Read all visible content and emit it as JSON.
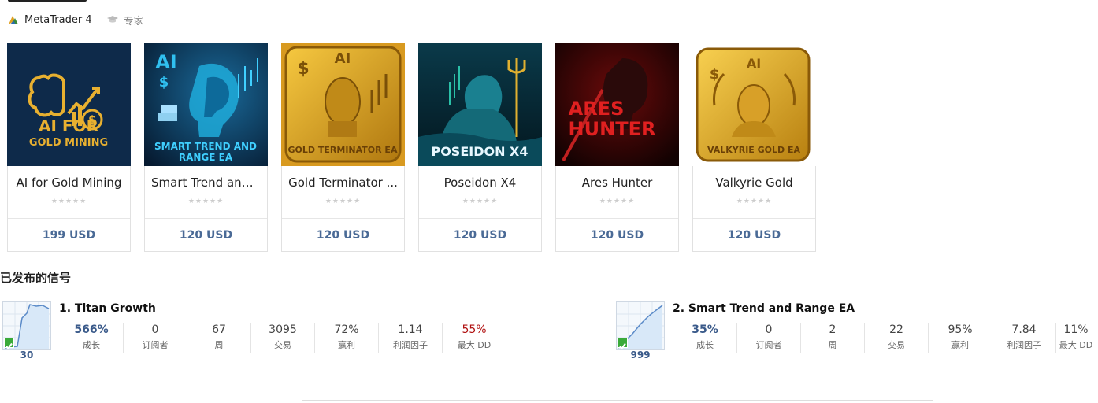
{
  "tabs": [
    {
      "label": "MetaTrader 4",
      "icon": "metatrader-icon"
    },
    {
      "label": "专家",
      "icon": "graduation-cap-icon"
    }
  ],
  "products": [
    {
      "image_text_line1": "AI FOR",
      "image_text_line2": "GOLD MINING",
      "name": "AI for Gold Mining",
      "stars": "★★★★★",
      "price": "199 USD"
    },
    {
      "image_text_line1": "SMART TREND AND",
      "image_text_line2": "RANGE EA",
      "name": "Smart Trend and ...",
      "stars": "★★★★★",
      "price": "120 USD"
    },
    {
      "image_text_line1": "GOLD TERMINATOR EA",
      "image_text_line2": "AI",
      "name": "Gold Terminator ...",
      "stars": "★★★★★",
      "price": "120 USD"
    },
    {
      "image_text_line1": "POSEIDON X4",
      "image_text_line2": "",
      "name": "Poseidon X4",
      "stars": "★★★★★",
      "price": "120 USD"
    },
    {
      "image_text_line1": "ARES",
      "image_text_line2": "HUNTER",
      "name": "Ares Hunter",
      "stars": "★★★★★",
      "price": "120 USD"
    },
    {
      "image_text_line1": "VALKYRIE GOLD EA",
      "image_text_line2": "AI",
      "name": "Valkyrie Gold",
      "stars": "★★★★★",
      "price": "120 USD"
    }
  ],
  "signals_title": "已发布的信号",
  "signals": [
    {
      "title": "1. Titan Growth",
      "count": "30",
      "stats": [
        {
          "value": "566%",
          "label": "成长"
        },
        {
          "value": "0",
          "label": "订阅者"
        },
        {
          "value": "67",
          "label": "周"
        },
        {
          "value": "3095",
          "label": "交易"
        },
        {
          "value": "72%",
          "label": "赢利"
        },
        {
          "value": "1.14",
          "label": "利润因子"
        },
        {
          "value": "55%",
          "label": "最大 DD"
        }
      ]
    },
    {
      "title": "2. Smart Trend and Range EA",
      "count": "999",
      "stats": [
        {
          "value": "35%",
          "label": "成长"
        },
        {
          "value": "0",
          "label": "订阅者"
        },
        {
          "value": "2",
          "label": "周"
        },
        {
          "value": "22",
          "label": "交易"
        },
        {
          "value": "95%",
          "label": "赢利"
        },
        {
          "value": "7.84",
          "label": "利润因子"
        },
        {
          "value": "11%",
          "label": "最大 DD"
        }
      ]
    }
  ],
  "colors": {
    "price": "#4a6a96",
    "growth": "#3a5a8a",
    "drawdown_high": "#b01010"
  }
}
